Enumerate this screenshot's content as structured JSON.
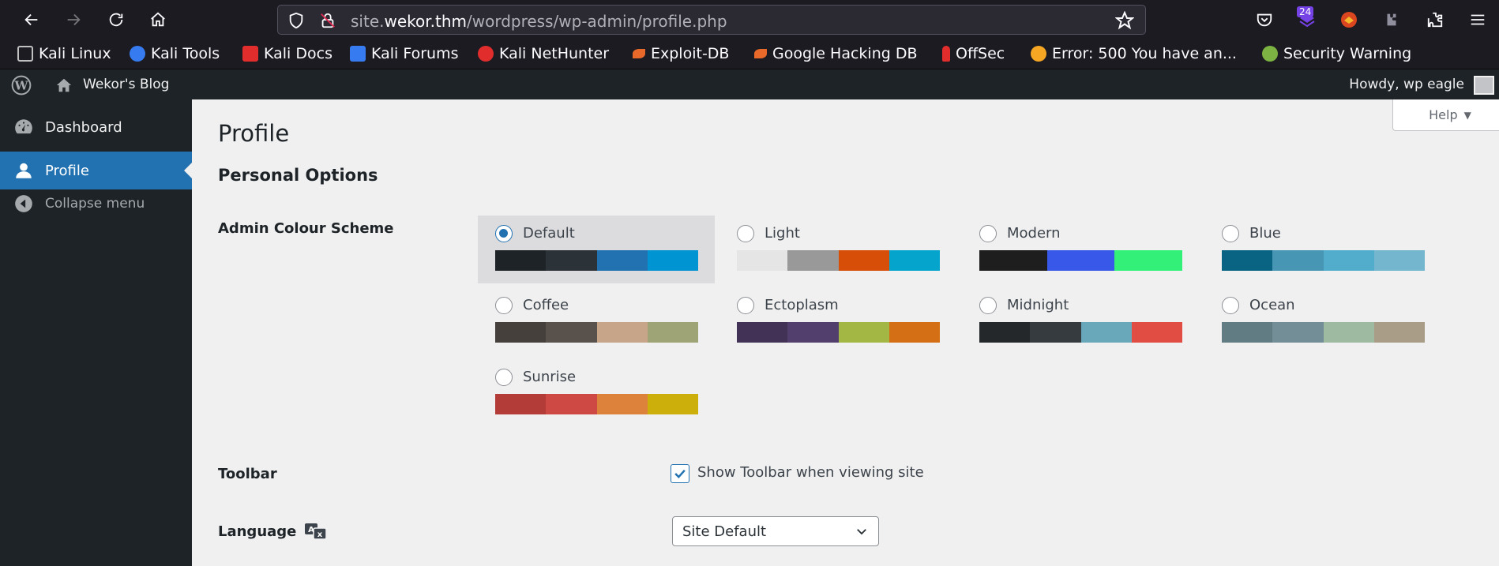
{
  "browser": {
    "url_prefix": "site.",
    "url_domain": "wekor.thm",
    "url_path": "/wordpress/wp-admin/profile.php",
    "extensions_badge": "24",
    "bookmarks": [
      {
        "label": "Kali Linux",
        "color": "#367bf0"
      },
      {
        "label": "Kali Tools",
        "color": "#367bf0"
      },
      {
        "label": "Kali Docs",
        "color": "#e22d2d"
      },
      {
        "label": "Kali Forums",
        "color": "#367bf0"
      },
      {
        "label": "Kali NetHunter",
        "color": "#e22d2d"
      },
      {
        "label": "Exploit-DB",
        "color": "#e8692a"
      },
      {
        "label": "Google Hacking DB",
        "color": "#e8692a"
      },
      {
        "label": "OffSec",
        "color": "#e22d2d"
      },
      {
        "label": "Error: 500 You have an...",
        "color": "#f5a623"
      },
      {
        "label": "Security Warning",
        "color": "#7cb342"
      }
    ]
  },
  "adminbar": {
    "site_name": "Wekor's Blog",
    "howdy": "Howdy, wp eagle"
  },
  "sidebar": {
    "items": [
      {
        "label": "Dashboard",
        "icon": "dashboard-icon"
      },
      {
        "label": "Profile",
        "icon": "user-icon",
        "active": true
      },
      {
        "label": "Collapse menu",
        "icon": "collapse-icon"
      }
    ]
  },
  "main": {
    "help_label": "Help",
    "page_title": "Profile",
    "section_title": "Personal Options",
    "colour_scheme_label": "Admin Colour Scheme",
    "schemes": [
      {
        "name": "Default",
        "checked": true,
        "colors": [
          "#1d2327",
          "#2c3338",
          "#2271b1",
          "#0095d2"
        ]
      },
      {
        "name": "Light",
        "checked": false,
        "colors": [
          "#e5e5e5",
          "#999999",
          "#d64e07",
          "#04a4cc"
        ]
      },
      {
        "name": "Modern",
        "checked": false,
        "colors": [
          "#1e1e1e",
          "#3858e9",
          "#33f078"
        ]
      },
      {
        "name": "Blue",
        "checked": false,
        "colors": [
          "#096484",
          "#4796b3",
          "#52accc",
          "#74b6ce"
        ]
      },
      {
        "name": "Coffee",
        "checked": false,
        "colors": [
          "#46403c",
          "#59524c",
          "#c7a589",
          "#9ea476"
        ]
      },
      {
        "name": "Ectoplasm",
        "checked": false,
        "colors": [
          "#413256",
          "#523f6d",
          "#a3b745",
          "#d46f15"
        ]
      },
      {
        "name": "Midnight",
        "checked": false,
        "colors": [
          "#25282b",
          "#363b3f",
          "#69a8bb",
          "#e14d43"
        ]
      },
      {
        "name": "Ocean",
        "checked": false,
        "colors": [
          "#627c83",
          "#738e96",
          "#9ebaa0",
          "#aa9d88"
        ]
      },
      {
        "name": "Sunrise",
        "checked": false,
        "colors": [
          "#b43c38",
          "#cf4944",
          "#dd823b",
          "#ccaf0b"
        ]
      }
    ],
    "toolbar_label": "Toolbar",
    "toolbar_checkbox_label": "Show Toolbar when viewing site",
    "toolbar_checked": true,
    "language_label": "Language",
    "language_value": "Site Default"
  }
}
